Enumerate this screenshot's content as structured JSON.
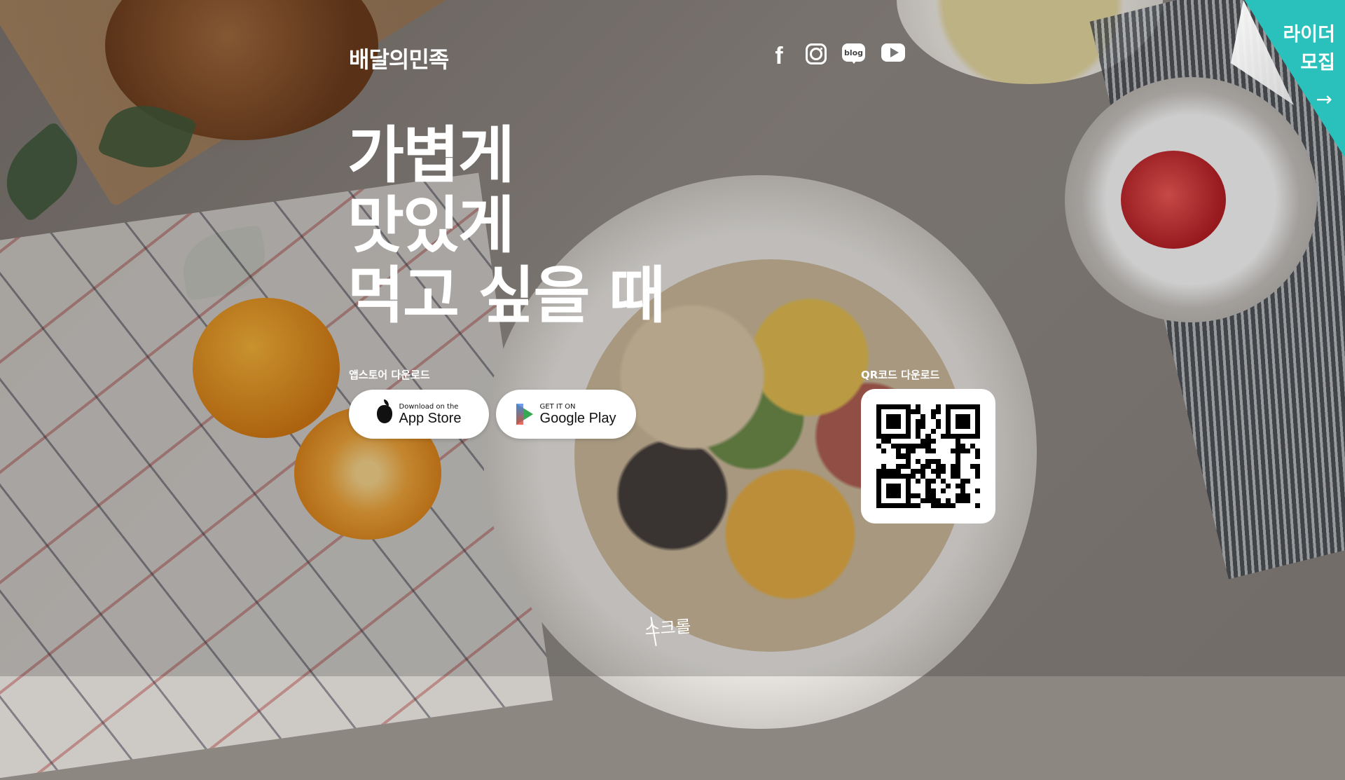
{
  "header": {
    "logo": "배달의민족",
    "social": [
      {
        "name": "facebook",
        "glyph": "f"
      },
      {
        "name": "instagram",
        "glyph": ""
      },
      {
        "name": "blog",
        "glyph": "blog"
      },
      {
        "name": "youtube",
        "glyph": ""
      }
    ]
  },
  "hero": {
    "lines": [
      "가볍게",
      "맛있게",
      "먹고 싶을 때"
    ]
  },
  "app_download": {
    "label": "앱스토어 다운로드",
    "app_store": {
      "small": "Download on the",
      "big": "App Store"
    },
    "google_play": {
      "small": "GET IT ON",
      "big": "Google Play"
    }
  },
  "qr": {
    "label": "QR코드 다운로드"
  },
  "scroll": "스크롤",
  "rider": {
    "line1": "라이더",
    "line2": "모집",
    "arrow": "→",
    "accent": "#2ac1bc"
  }
}
